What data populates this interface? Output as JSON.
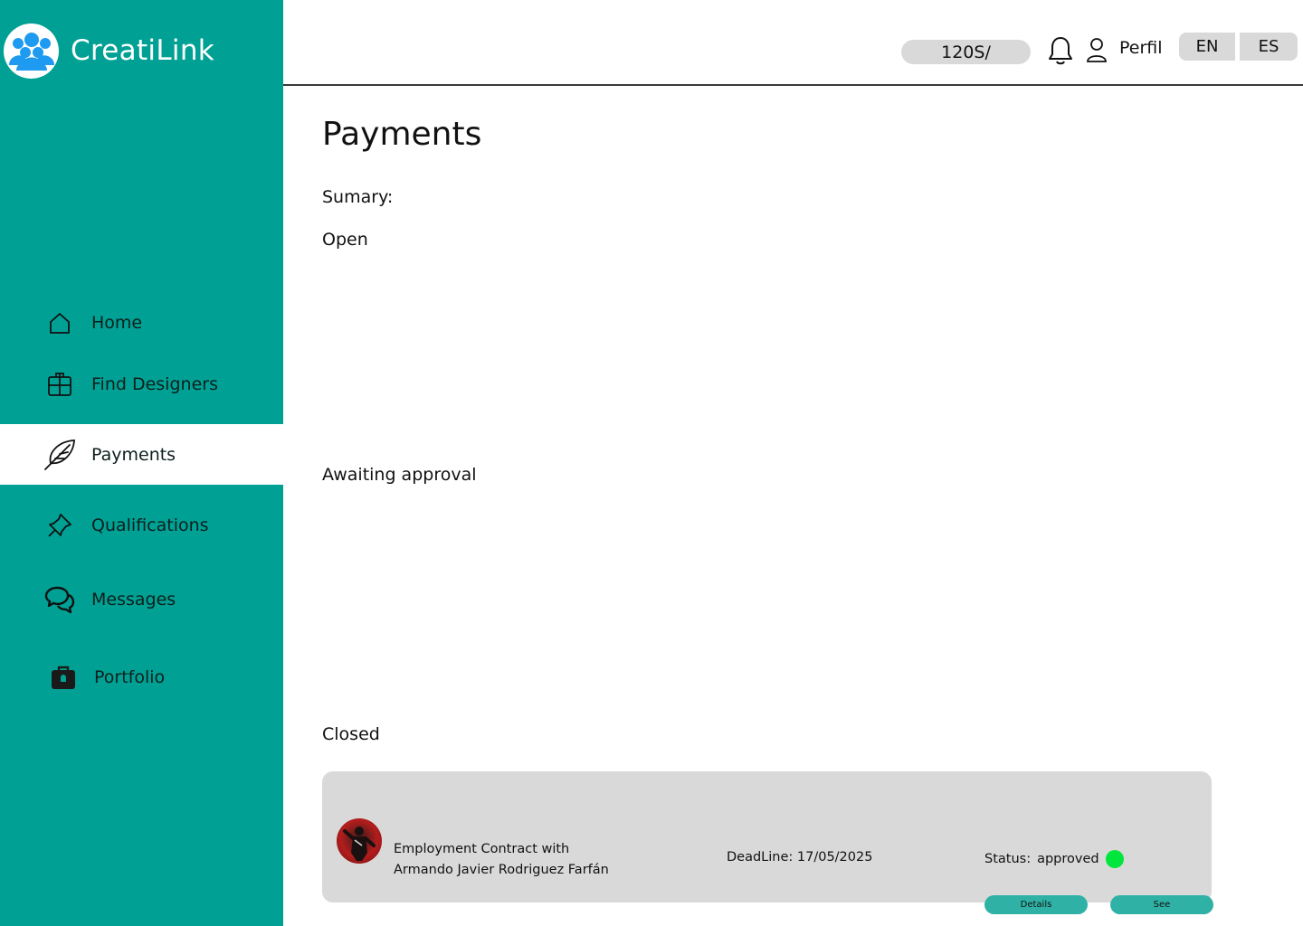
{
  "brand": {
    "name": "CreatiLink",
    "logo_icon": "people-group-icon"
  },
  "sidebar": {
    "items": [
      {
        "label": "Home",
        "icon": "home-icon",
        "active": false
      },
      {
        "label": "Find Designers",
        "icon": "grid-box-icon",
        "active": false
      },
      {
        "label": "Payments",
        "icon": "feather-icon",
        "active": true
      },
      {
        "label": "Qualifications",
        "icon": "pin-icon",
        "active": false
      },
      {
        "label": "Messages",
        "icon": "chat-bubbles-icon",
        "active": false
      },
      {
        "label": "Portfolio",
        "icon": "briefcase-icon",
        "active": false
      }
    ]
  },
  "topbar": {
    "balance": "120S/",
    "profile_label": "Perfil",
    "languages": [
      "EN",
      "ES"
    ]
  },
  "main": {
    "title": "Payments",
    "summary_label": "Sumary:",
    "sections": {
      "open": "Open",
      "awaiting": "Awaiting approval",
      "closed": "Closed"
    },
    "closed_card": {
      "contract_line1": "Employment Contract with",
      "contract_line2": "Armando Javier Rodriguez Farfán",
      "deadline": "DeadLine: 17/05/2025",
      "status_label": "Status:",
      "status_value": "approved",
      "details_button": "Details",
      "see_button": "See"
    }
  },
  "colors": {
    "sidebar": "#00a194",
    "accent_button": "#2fb2a5",
    "card_bg": "#d9d9d9",
    "status_approved": "#00e63c"
  }
}
